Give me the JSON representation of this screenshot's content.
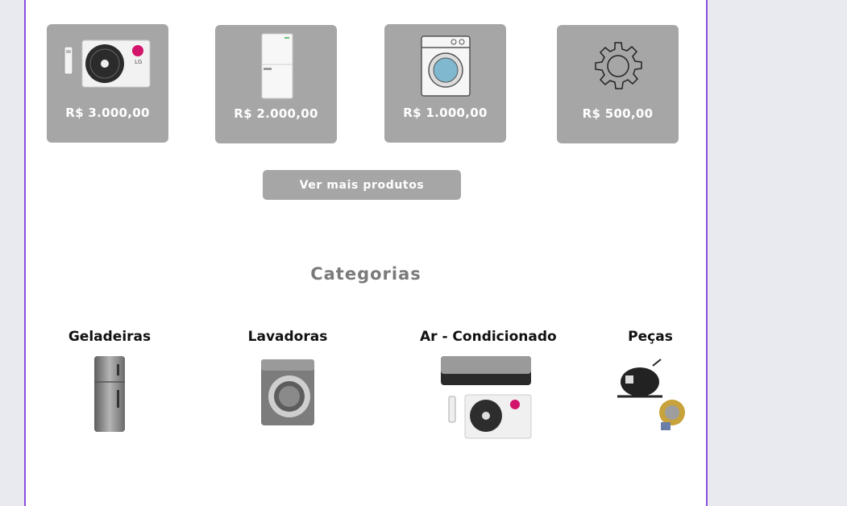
{
  "products": [
    {
      "price": "R$ 3.000,00",
      "icon": "air-conditioner-icon"
    },
    {
      "price": "R$ 2.000,00",
      "icon": "refrigerator-icon"
    },
    {
      "price": "R$ 1.000,00",
      "icon": "washing-machine-icon"
    },
    {
      "price": "R$ 500,00",
      "icon": "gear-icon"
    }
  ],
  "more_button": "Ver mais produtos",
  "categories_title": "Categorias",
  "categories": [
    {
      "label": "Geladeiras",
      "icon": "refrigerator-icon"
    },
    {
      "label": "Lavadoras",
      "icon": "washing-machine-icon"
    },
    {
      "label": "Ar - Condicionado",
      "icon": "air-conditioner-icon"
    },
    {
      "label": "Peças",
      "icon": "compressor-icon"
    }
  ],
  "colors": {
    "card_bg": "#a6a6a6",
    "border_accent": "#8a4fe0",
    "page_bg": "#e9eaef",
    "title_gray": "#7a7a7a"
  }
}
